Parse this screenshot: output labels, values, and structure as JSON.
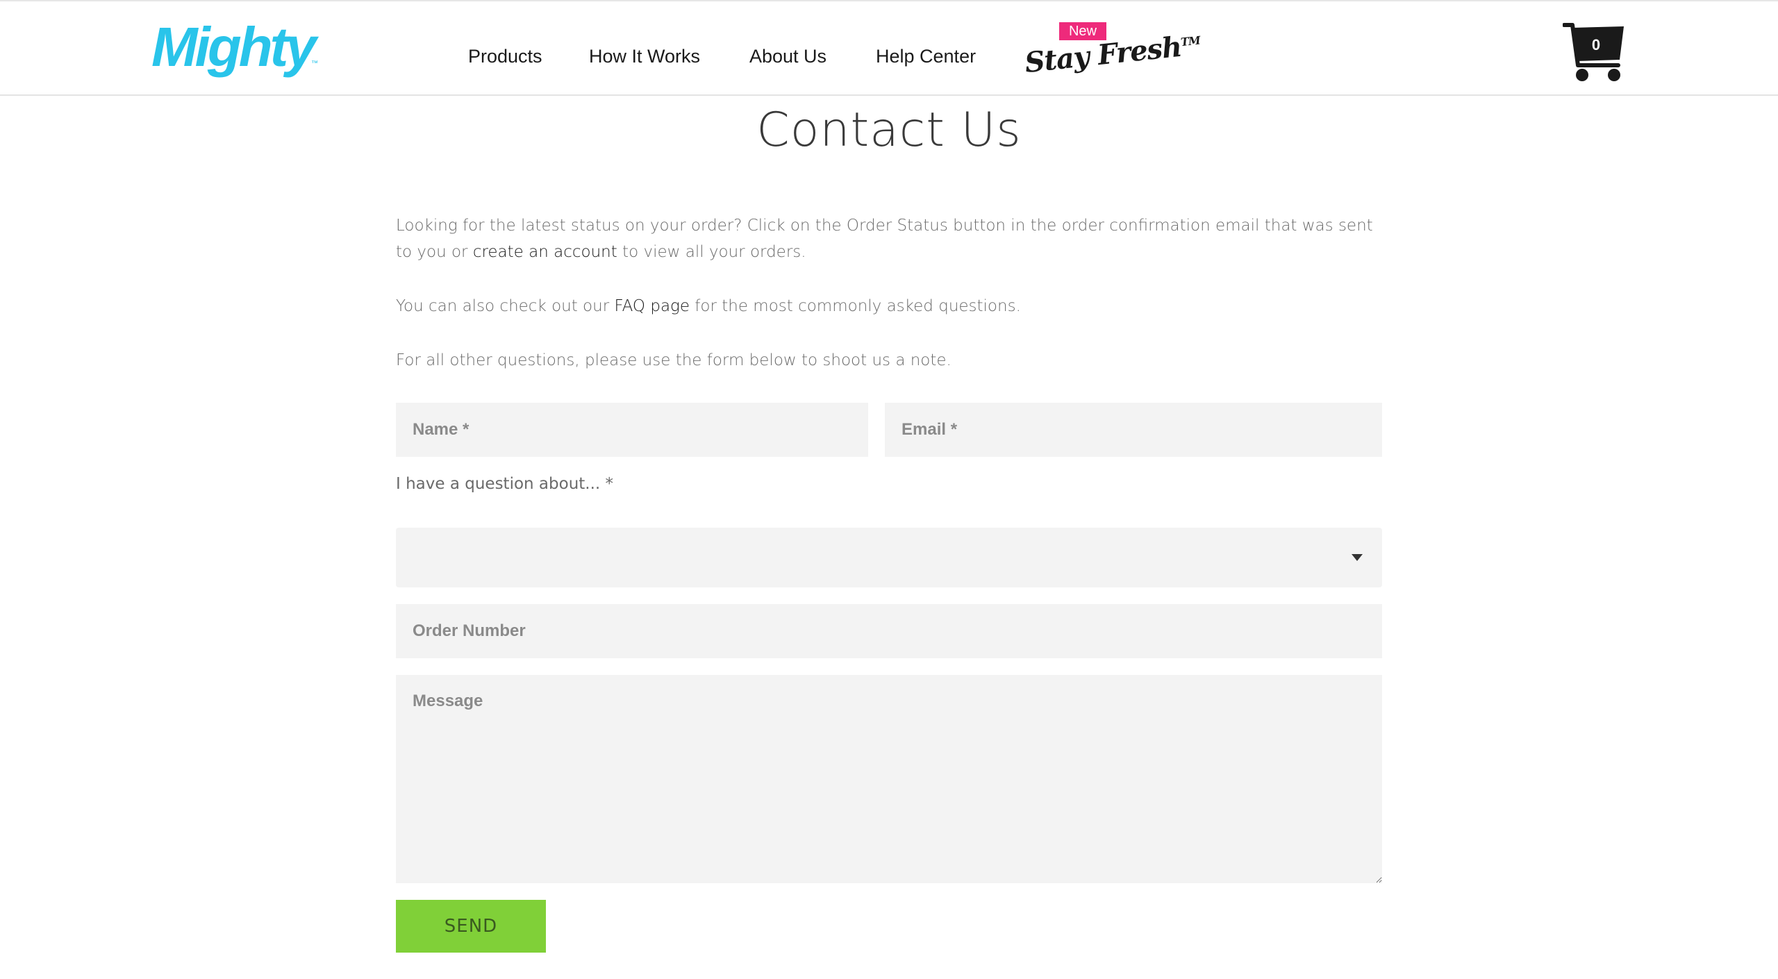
{
  "header": {
    "logo_text": "Mighty",
    "logo_tm": "™",
    "nav": {
      "products": "Products",
      "how_it_works": "How It Works",
      "about_us": "About Us",
      "help_center": "Help Center",
      "stay_fresh": "Stay Fresh",
      "stay_fresh_tm": "TM",
      "new_badge": "New"
    },
    "cart_count": "0",
    "accent_color": "#29c4ea",
    "badge_color": "#ee2a7b"
  },
  "page": {
    "title": "Contact Us",
    "para1_before": "Looking for the latest status on your order? Click on the Order Status button in the order confirmation email that was sent to you or ",
    "para1_link": "create an account",
    "para1_after": " to view all your orders.",
    "para2_before": "You can also check out our ",
    "para2_link": "FAQ page",
    "para2_after": " for the most commonly asked questions.",
    "para3": "For all other questions, please use the form below to shoot us a note."
  },
  "form": {
    "name_placeholder": "Name *",
    "email_placeholder": "Email *",
    "question_label": "I have a question about... *",
    "question_value": "",
    "order_placeholder": "Order Number",
    "message_placeholder": "Message",
    "send_label": "SEND",
    "send_color": "#80d038"
  }
}
